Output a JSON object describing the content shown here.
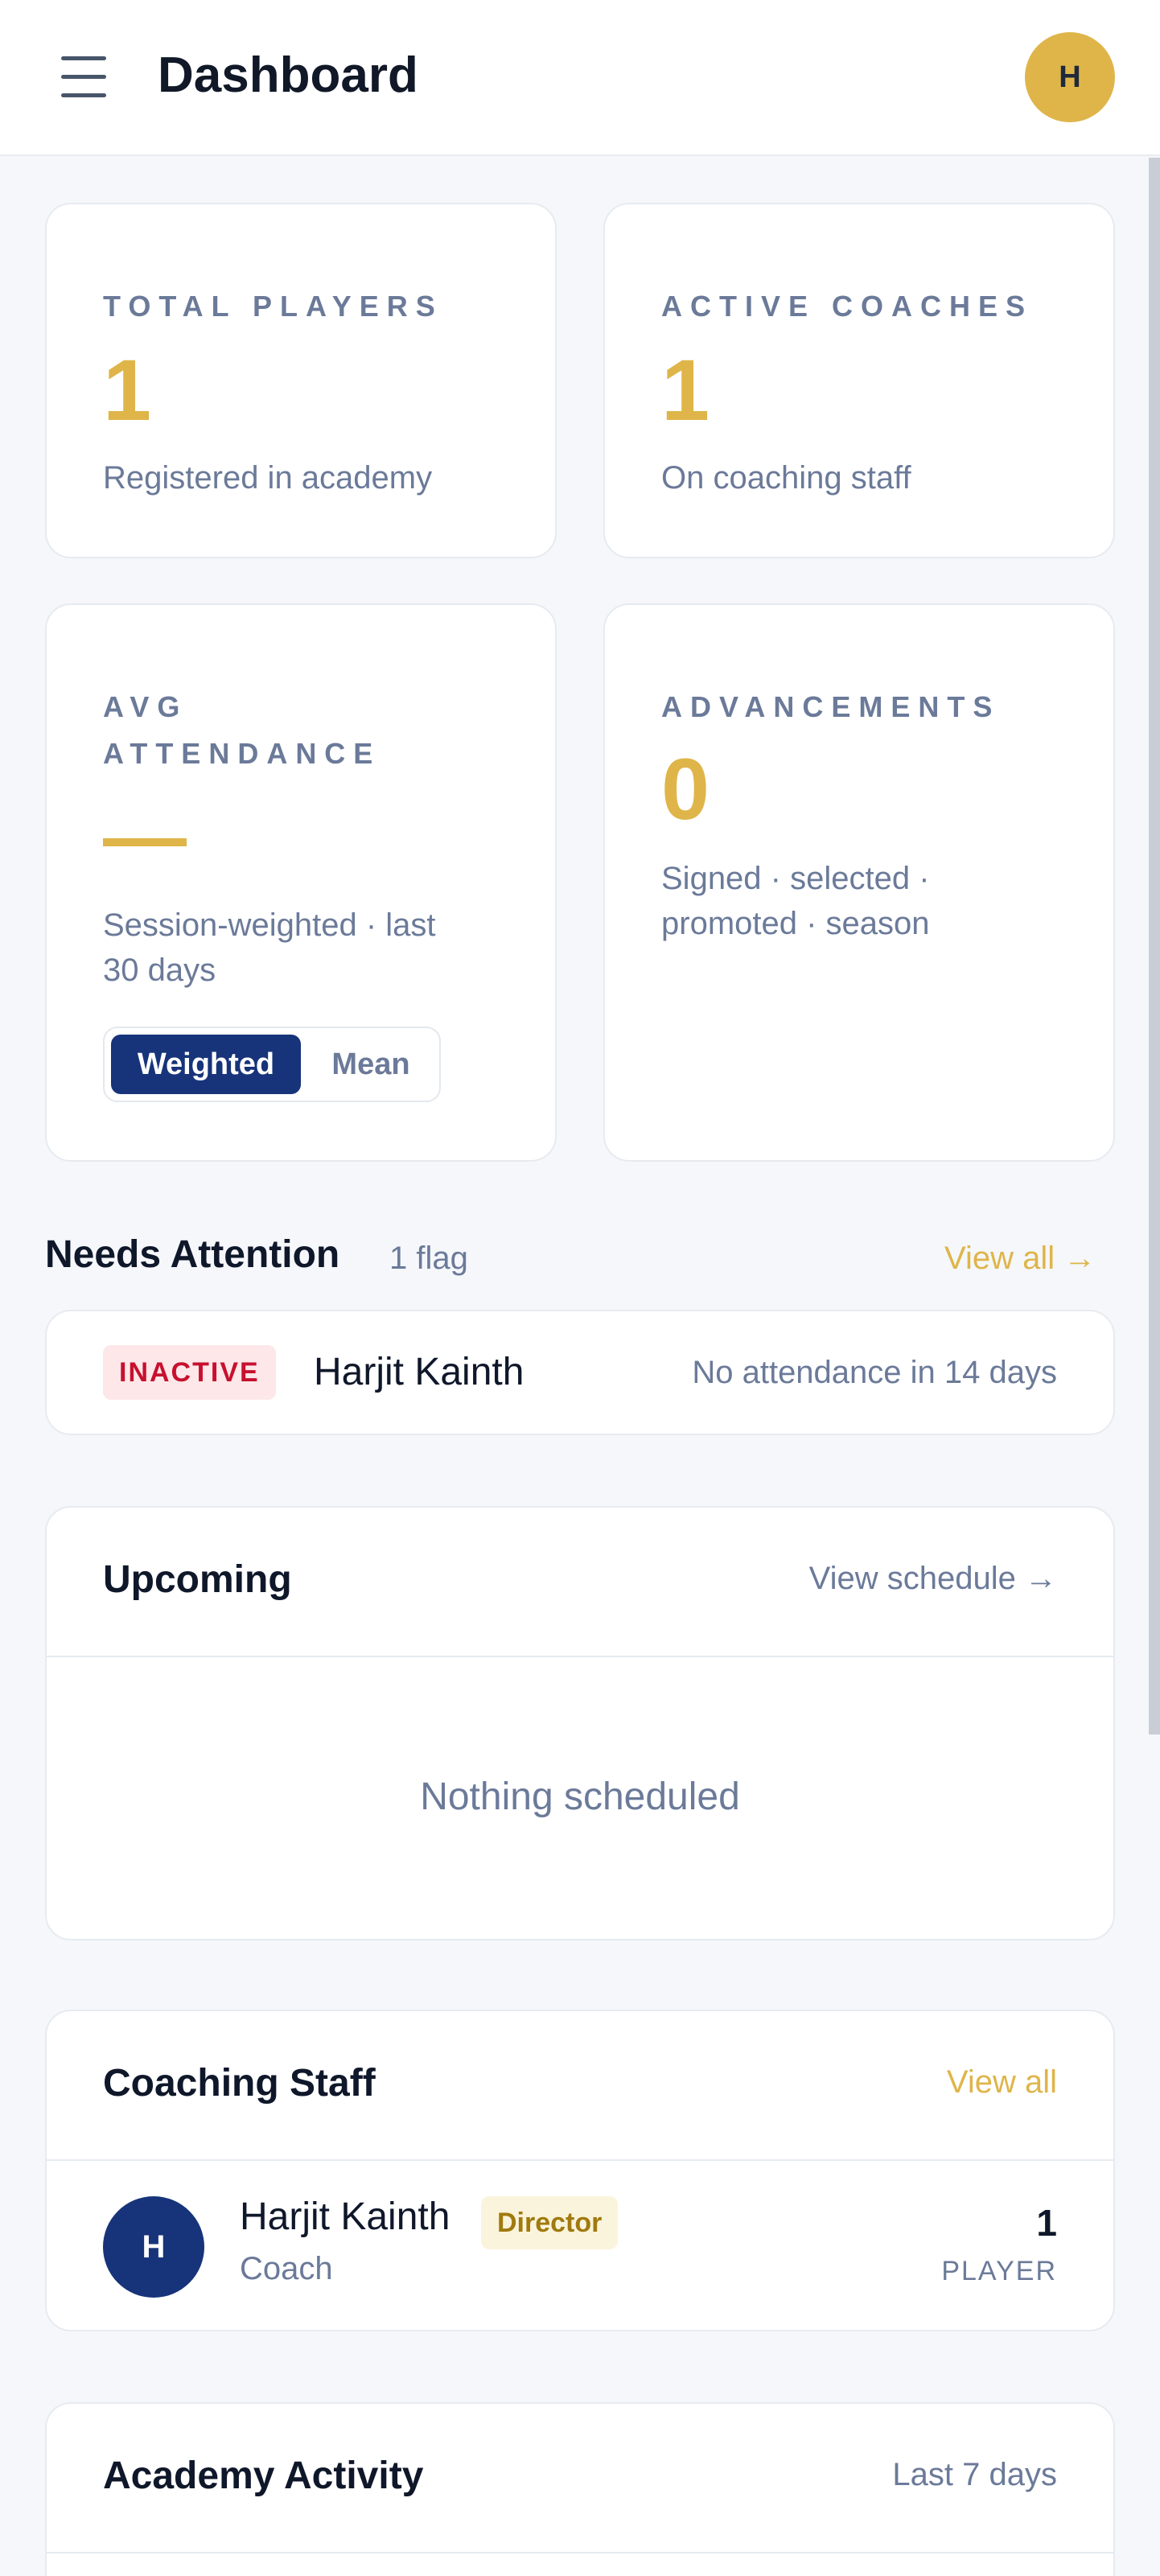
{
  "header": {
    "menu_icon": "hamburger-menu-icon",
    "title": "Dashboard",
    "avatar_initial": "H"
  },
  "stats": {
    "total_players": {
      "label": "TOTAL PLAYERS",
      "value": "1",
      "sub": "Registered in academy"
    },
    "active_coaches": {
      "label": "ACTIVE COACHES",
      "value": "1",
      "sub": "On coaching staff"
    },
    "avg_attendance": {
      "label_line1": "AVG",
      "label_line2": "ATTENDANCE",
      "value": "—",
      "sub_line1": "Session-weighted · last",
      "sub_line2": "30 days",
      "toggle": {
        "selected": "Weighted",
        "options": [
          "Weighted",
          "Mean"
        ]
      }
    },
    "advancements": {
      "label": "ADVANCEMENTS",
      "value": "0",
      "sub_line1": "Signed · selected ·",
      "sub_line2": "promoted · season"
    }
  },
  "needs_attention": {
    "title": "Needs Attention",
    "count": "1 flag",
    "view_all": "View all →",
    "items": [
      {
        "badge": "INACTIVE",
        "name": "Harjit Kainth",
        "detail": "No attendance in 14 days"
      }
    ]
  },
  "upcoming": {
    "title": "Upcoming",
    "link": "View schedule →",
    "empty": "Nothing scheduled"
  },
  "coaching_staff": {
    "title": "Coaching Staff",
    "link": "View all",
    "members": [
      {
        "initial": "H",
        "name": "Harjit Kainth",
        "badge": "Director",
        "role": "Coach",
        "count": "1",
        "count_label": "PLAYER"
      }
    ]
  },
  "academy_activity": {
    "title": "Academy Activity",
    "range": "Last 7 days"
  },
  "colors": {
    "accent_gold": "#dfb54a",
    "navy": "#17347a",
    "muted": "#6b7a99",
    "danger": "#c8102e"
  }
}
